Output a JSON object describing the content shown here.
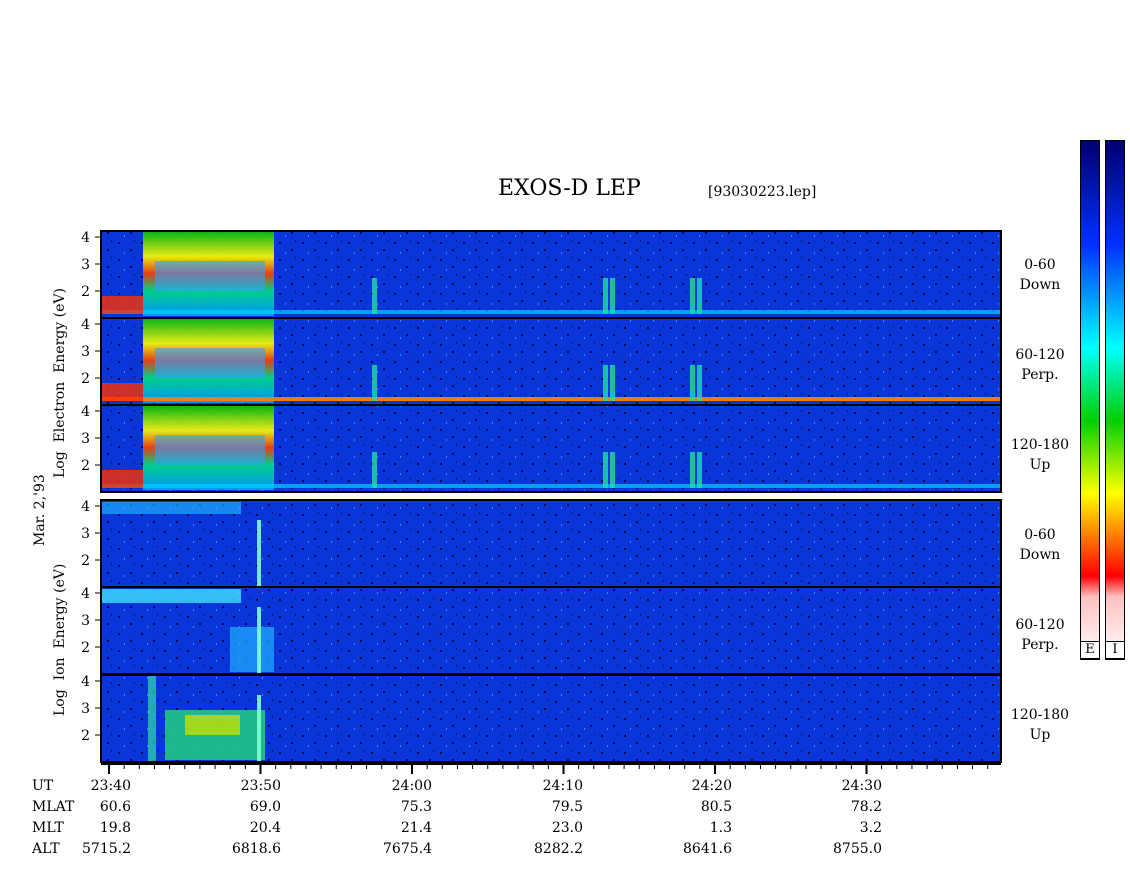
{
  "header": {
    "title": "EXOS-D LEP",
    "file_name": "[93030223.lep]"
  },
  "left_axis": {
    "date_label": "Mar. 2,'93",
    "electron_label": "Log  Electron  Energy (eV)",
    "ion_label": "Log  Ion  Energy (eV)"
  },
  "panels": [
    {
      "id": "e-0-60",
      "group": "electron",
      "pitch": "0-60",
      "dir": "Down",
      "ticks": [
        "4",
        "3",
        "2"
      ]
    },
    {
      "id": "e-60-120",
      "group": "electron",
      "pitch": "60-120",
      "dir": "Perp.",
      "ticks": [
        "4",
        "3",
        "2"
      ]
    },
    {
      "id": "e-120-180",
      "group": "electron",
      "pitch": "120-180",
      "dir": "Up",
      "ticks": [
        "4",
        "3",
        "2"
      ]
    },
    {
      "id": "i-0-60",
      "group": "ion",
      "pitch": "0-60",
      "dir": "Down",
      "ticks": [
        "4",
        "3",
        "2"
      ]
    },
    {
      "id": "i-60-120",
      "group": "ion",
      "pitch": "60-120",
      "dir": "Perp.",
      "ticks": [
        "4",
        "3",
        "2"
      ]
    },
    {
      "id": "i-120-180",
      "group": "ion",
      "pitch": "120-180",
      "dir": "Up",
      "ticks": [
        "4",
        "3",
        "2"
      ]
    }
  ],
  "colorbar": {
    "labels": [
      "E",
      "I"
    ]
  },
  "time_axis": {
    "row_names": [
      "UT",
      "MLAT",
      "MLT",
      "ALT"
    ],
    "columns": [
      {
        "UT": "23:40",
        "MLAT": "60.6",
        "MLT": "19.8",
        "ALT": "5715.2"
      },
      {
        "UT": "23:50",
        "MLAT": "69.0",
        "MLT": "20.4",
        "ALT": "6818.6"
      },
      {
        "UT": "24:00",
        "MLAT": "75.3",
        "MLT": "21.4",
        "ALT": "7675.4"
      },
      {
        "UT": "24:10",
        "MLAT": "79.5",
        "MLT": "23.0",
        "ALT": "8282.2"
      },
      {
        "UT": "24:20",
        "MLAT": "80.5",
        "MLT": "1.3",
        "ALT": "8641.6"
      },
      {
        "UT": "24:30",
        "MLAT": "78.2",
        "MLT": "3.2",
        "ALT": "8755.0"
      }
    ]
  },
  "chart_data": {
    "type": "heatmap",
    "title": "EXOS-D LEP",
    "subtitle": "[93030223.lep]",
    "xlabel": "UT",
    "ylabel": "Log Energy (eV)",
    "x_ticks": [
      "23:40",
      "23:50",
      "24:00",
      "24:10",
      "24:20",
      "24:30"
    ],
    "y_ticks": [
      "2",
      "3",
      "4"
    ],
    "panel_labels": [
      "0-60 Down",
      "60-120 Perp.",
      "120-180 Up"
    ],
    "groups": [
      "Electron",
      "Ion"
    ],
    "colorscale": [
      "#000080",
      "#0000ff",
      "#00ffff",
      "#00ff00",
      "#ffff00",
      "#ff8000",
      "#ff0000",
      "#ffd0d0",
      "#ffffff"
    ],
    "grid": false
  }
}
